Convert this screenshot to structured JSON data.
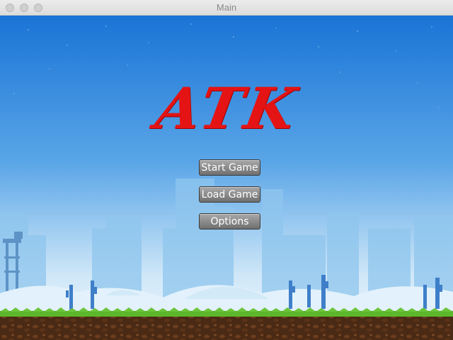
{
  "window": {
    "title": "Main"
  },
  "game": {
    "logo_text": "ATK",
    "menu": {
      "start_label": "Start Game",
      "load_label": "Load Game",
      "options_label": "Options"
    }
  },
  "colors": {
    "sky_top": "#1a74d6",
    "sky_mid": "#5aa6e8",
    "sky_bottom": "#e6f3fb",
    "logo_red": "#e41414",
    "grass": "#5cb82a",
    "soil": "#4a2a14",
    "button_gray": "#8a8a8a"
  }
}
